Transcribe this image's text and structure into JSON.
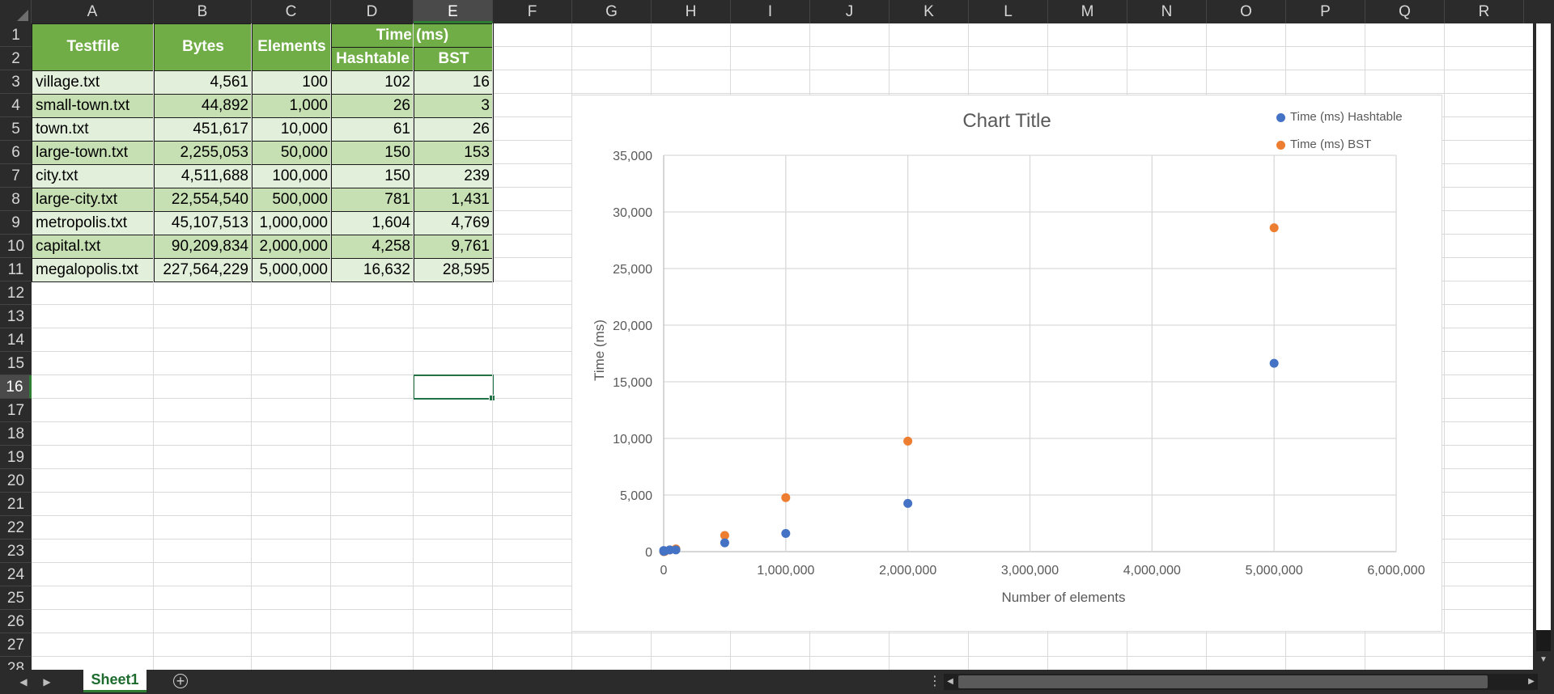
{
  "columns": [
    "A",
    "B",
    "C",
    "D",
    "E",
    "F",
    "G",
    "H",
    "I",
    "J",
    "K",
    "L",
    "M",
    "N",
    "O",
    "P",
    "Q",
    "R"
  ],
  "rows": [
    "1",
    "2",
    "3",
    "4",
    "5",
    "6",
    "7",
    "8",
    "9",
    "10",
    "11",
    "12",
    "13",
    "14",
    "15",
    "16",
    "17",
    "18",
    "19",
    "20",
    "21",
    "22",
    "23",
    "24",
    "25",
    "26",
    "27",
    "28"
  ],
  "selected": {
    "column": "E",
    "row": "16"
  },
  "table": {
    "headers": {
      "testfile": "Testfile",
      "bytes": "Bytes",
      "elements": "Elements",
      "time": "Time (ms)",
      "hashtable": "Hashtable",
      "bst": "BST"
    },
    "rows": [
      {
        "file": "village.txt",
        "bytes": "4,561",
        "elements": "100",
        "hashtable": "102",
        "bst": "16"
      },
      {
        "file": "small-town.txt",
        "bytes": "44,892",
        "elements": "1,000",
        "hashtable": "26",
        "bst": "3"
      },
      {
        "file": "town.txt",
        "bytes": "451,617",
        "elements": "10,000",
        "hashtable": "61",
        "bst": "26"
      },
      {
        "file": "large-town.txt",
        "bytes": "2,255,053",
        "elements": "50,000",
        "hashtable": "150",
        "bst": "153"
      },
      {
        "file": "city.txt",
        "bytes": "4,511,688",
        "elements": "100,000",
        "hashtable": "150",
        "bst": "239"
      },
      {
        "file": "large-city.txt",
        "bytes": "22,554,540",
        "elements": "500,000",
        "hashtable": "781",
        "bst": "1,431"
      },
      {
        "file": "metropolis.txt",
        "bytes": "45,107,513",
        "elements": "1,000,000",
        "hashtable": "1,604",
        "bst": "4,769"
      },
      {
        "file": "capital.txt",
        "bytes": "90,209,834",
        "elements": "2,000,000",
        "hashtable": "4,258",
        "bst": "9,761"
      },
      {
        "file": "megalopolis.txt",
        "bytes": "227,564,229",
        "elements": "5,000,000",
        "hashtable": "16,632",
        "bst": "28,595"
      }
    ]
  },
  "chart_data": {
    "type": "scatter",
    "title": "Chart Title",
    "xlabel": "Number of elements",
    "ylabel": "Time (ms)",
    "xlim": [
      0,
      6000000
    ],
    "ylim": [
      0,
      35000
    ],
    "x_ticks": [
      "0",
      "1,000,000",
      "2,000,000",
      "3,000,000",
      "4,000,000",
      "5,000,000",
      "6,000,000"
    ],
    "y_ticks": [
      "0",
      "5,000",
      "10,000",
      "15,000",
      "20,000",
      "25,000",
      "30,000",
      "35,000"
    ],
    "grid": true,
    "legend_position": "top-right",
    "x": [
      100,
      1000,
      10000,
      50000,
      100000,
      500000,
      1000000,
      2000000,
      5000000
    ],
    "series": [
      {
        "name": "Time (ms) Hashtable",
        "color": "#4472c4",
        "values": [
          102,
          26,
          61,
          150,
          150,
          781,
          1604,
          4258,
          16632
        ]
      },
      {
        "name": "Time (ms) BST",
        "color": "#ed7d31",
        "values": [
          16,
          3,
          26,
          153,
          239,
          1431,
          4769,
          9761,
          28595
        ]
      }
    ]
  },
  "sheet_tabs": [
    "Sheet1"
  ],
  "icons": {
    "add_sheet": "plus-circle-icon",
    "prev_sheet": "chevron-left-icon",
    "next_sheet": "chevron-right-icon"
  }
}
